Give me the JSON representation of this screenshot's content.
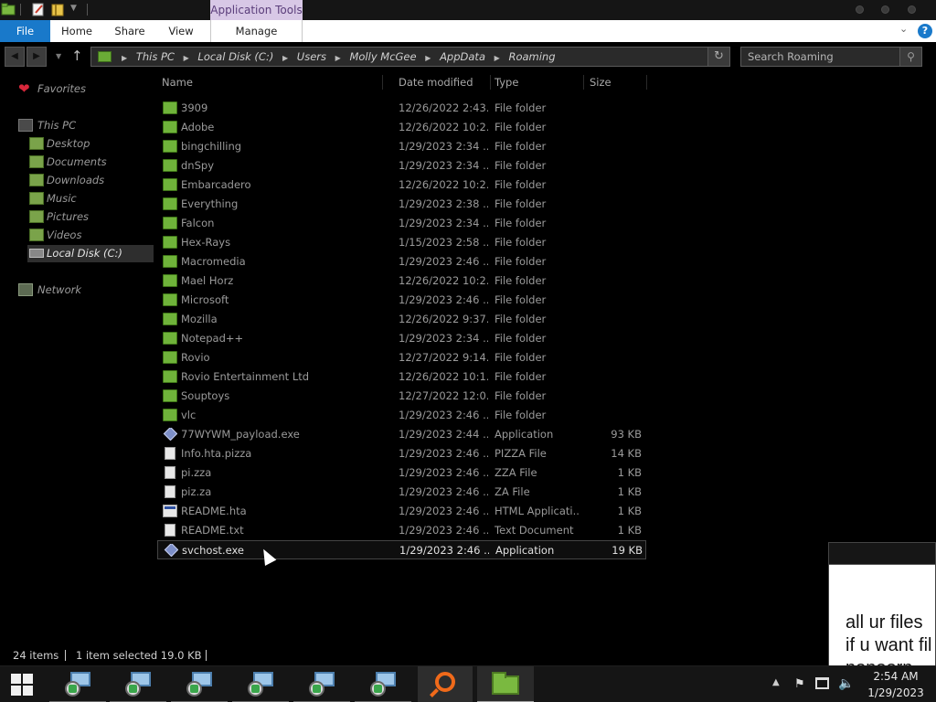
{
  "titlebar": {
    "context_tab": "Application Tools"
  },
  "ribbon": {
    "tabs": [
      "File",
      "Home",
      "Share",
      "View",
      "Manage"
    ],
    "help_label": "?"
  },
  "address": {
    "crumbs": [
      "This PC",
      "Local Disk (C:)",
      "Users",
      "Molly McGee",
      "AppData",
      "Roaming"
    ]
  },
  "search": {
    "placeholder": "Search Roaming"
  },
  "nav": {
    "favorites": "Favorites",
    "this_pc": "This PC",
    "items": [
      "Desktop",
      "Documents",
      "Downloads",
      "Music",
      "Pictures",
      "Videos",
      "Local Disk (C:)"
    ],
    "network": "Network"
  },
  "columns": {
    "name": "Name",
    "date": "Date modified",
    "type": "Type",
    "size": "Size"
  },
  "files": [
    {
      "name": "3909",
      "date": "12/26/2022 2:43...",
      "type": "File folder",
      "size": "",
      "icon": "folder-icon"
    },
    {
      "name": "Adobe",
      "date": "12/26/2022 10:2...",
      "type": "File folder",
      "size": "",
      "icon": "folder-icon"
    },
    {
      "name": "bingchilling",
      "date": "1/29/2023 2:34 ...",
      "type": "File folder",
      "size": "",
      "icon": "folder-icon"
    },
    {
      "name": "dnSpy",
      "date": "1/29/2023 2:34 ...",
      "type": "File folder",
      "size": "",
      "icon": "folder-icon"
    },
    {
      "name": "Embarcadero",
      "date": "12/26/2022 10:2...",
      "type": "File folder",
      "size": "",
      "icon": "folder-icon"
    },
    {
      "name": "Everything",
      "date": "1/29/2023 2:38 ...",
      "type": "File folder",
      "size": "",
      "icon": "folder-icon"
    },
    {
      "name": "Falcon",
      "date": "1/29/2023 2:34 ...",
      "type": "File folder",
      "size": "",
      "icon": "folder-icon"
    },
    {
      "name": "Hex-Rays",
      "date": "1/15/2023 2:58 ...",
      "type": "File folder",
      "size": "",
      "icon": "folder-icon"
    },
    {
      "name": "Macromedia",
      "date": "1/29/2023 2:46 ...",
      "type": "File folder",
      "size": "",
      "icon": "folder-icon"
    },
    {
      "name": "Mael Horz",
      "date": "12/26/2022 10:2...",
      "type": "File folder",
      "size": "",
      "icon": "folder-icon"
    },
    {
      "name": "Microsoft",
      "date": "1/29/2023 2:46 ...",
      "type": "File folder",
      "size": "",
      "icon": "folder-icon"
    },
    {
      "name": "Mozilla",
      "date": "12/26/2022 9:37...",
      "type": "File folder",
      "size": "",
      "icon": "folder-icon"
    },
    {
      "name": "Notepad++",
      "date": "1/29/2023 2:34 ...",
      "type": "File folder",
      "size": "",
      "icon": "folder-icon"
    },
    {
      "name": "Rovio",
      "date": "12/27/2022 9:14...",
      "type": "File folder",
      "size": "",
      "icon": "folder-icon"
    },
    {
      "name": "Rovio Entertainment Ltd",
      "date": "12/26/2022 10:1...",
      "type": "File folder",
      "size": "",
      "icon": "folder-icon"
    },
    {
      "name": "Souptoys",
      "date": "12/27/2022 12:0...",
      "type": "File folder",
      "size": "",
      "icon": "folder-icon"
    },
    {
      "name": "vlc",
      "date": "1/29/2023 2:46 ...",
      "type": "File folder",
      "size": "",
      "icon": "folder-icon"
    },
    {
      "name": "77WYWM_payload.exe",
      "date": "1/29/2023 2:44 ...",
      "type": "Application",
      "size": "93 KB",
      "icon": "application-icon"
    },
    {
      "name": "Info.hta.pizza",
      "date": "1/29/2023 2:46 ...",
      "type": "PIZZA File",
      "size": "14 KB",
      "icon": "document-icon"
    },
    {
      "name": "pi.zza",
      "date": "1/29/2023 2:46 ...",
      "type": "ZZA File",
      "size": "1 KB",
      "icon": "document-icon"
    },
    {
      "name": "piz.za",
      "date": "1/29/2023 2:46 ...",
      "type": "ZA File",
      "size": "1 KB",
      "icon": "document-icon"
    },
    {
      "name": "README.hta",
      "date": "1/29/2023 2:46 ...",
      "type": "HTML Applicati...",
      "size": "1 KB",
      "icon": "html-application-icon"
    },
    {
      "name": "README.txt",
      "date": "1/29/2023 2:46 ...",
      "type": "Text Document",
      "size": "1 KB",
      "icon": "text-document-icon"
    },
    {
      "name": "svchost.exe",
      "date": "1/29/2023 2:46 ...",
      "type": "Application",
      "size": "19 KB",
      "icon": "application-icon",
      "selected": true
    }
  ],
  "status": {
    "item_count": "24 items",
    "selection": "1 item selected  19.0 KB"
  },
  "popup": {
    "line1": "all ur files",
    "line2": "if u want fil",
    "line3": "nonoorn"
  },
  "taskbar": {
    "time": "2:54 AM",
    "date": "1/29/2023"
  },
  "colors": {
    "accent_blue": "#1979ca",
    "context_tab_bg": "#d8c8e6",
    "folder_green": "#6fb33a",
    "search_orange": "#f06a1a"
  }
}
